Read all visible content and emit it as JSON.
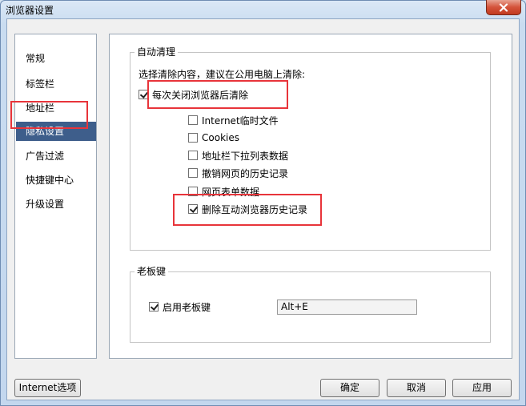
{
  "window": {
    "title": "浏览器设置"
  },
  "sidebar": {
    "items": [
      {
        "label": "常规"
      },
      {
        "label": "标签栏"
      },
      {
        "label": "地址栏"
      },
      {
        "label": "隐私设置"
      },
      {
        "label": "广告过滤"
      },
      {
        "label": "快捷键中心"
      },
      {
        "label": "升级设置"
      }
    ],
    "selected_index": 3
  },
  "auto_clean": {
    "title": "自动清理",
    "instruction": "选择清除内容，建议在公用电脑上清除:",
    "clear_on_close": {
      "label": "每次关闭浏览器后清除",
      "checked": true
    },
    "options": [
      {
        "label": "Internet临时文件",
        "checked": false
      },
      {
        "label": "Cookies",
        "checked": false
      },
      {
        "label": "地址栏下拉列表数据",
        "checked": false
      },
      {
        "label": "撤销网页的历史记录",
        "checked": false
      },
      {
        "label": "网页表单数据",
        "checked": false
      },
      {
        "label": "删除互动浏览器历史记录",
        "checked": true
      }
    ]
  },
  "boss_key": {
    "title": "老板键",
    "enable": {
      "label": "启用老板键",
      "checked": true
    },
    "shortcut_value": "Alt+E"
  },
  "buttons": {
    "internet_options": "Internet选项",
    "ok": "确定",
    "cancel": "取消",
    "apply": "应用"
  },
  "colors": {
    "selection": "#3e5e8b",
    "annotation_red": "#e8343a",
    "close_button": "#d4533a"
  }
}
